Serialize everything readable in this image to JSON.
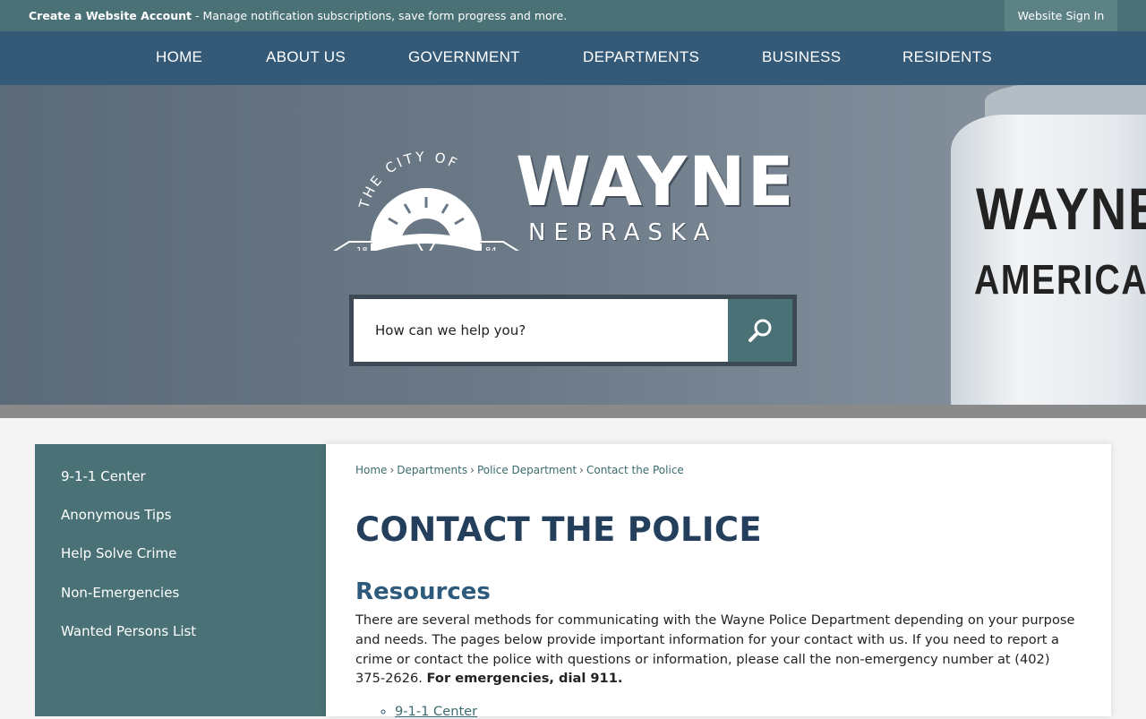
{
  "topbar": {
    "account_link": "Create a Website Account",
    "account_desc": " - Manage notification subscriptions, save form progress and more.",
    "signin_label": "Website Sign In"
  },
  "nav": {
    "items": [
      "HOME",
      "ABOUT US",
      "GOVERNMENT",
      "DEPARTMENTS",
      "BUSINESS",
      "RESIDENTS"
    ]
  },
  "hero": {
    "logo_arc_text": "THE CITY OF",
    "logo_word": "WAYNE",
    "logo_sub": "NEBRASKA",
    "logo_year_left": "18",
    "logo_year_right": "84",
    "tower_line1": "WAYNE",
    "tower_line2": "AMERICA",
    "search_placeholder": "How can we help you?",
    "search_icon": "magnifier-icon"
  },
  "sidebar": {
    "items": [
      "9-1-1 Center",
      "Anonymous Tips",
      "Help Solve Crime",
      "Non-Emergencies",
      "Wanted Persons List"
    ]
  },
  "breadcrumb": {
    "items": [
      "Home",
      "Departments",
      "Police Department",
      "Contact the Police"
    ],
    "separator": "›"
  },
  "page": {
    "title": "CONTACT THE POLICE",
    "section_title": "Resources",
    "paragraph_text": "There are several methods for communicating with the Wayne Police Department depending on your purpose and needs.  The pages below provide important information for your contact with us.  If you need to report a crime or contact the police with questions or information, please call the non-emergency number at (402) 375-2626.  ",
    "paragraph_bold": "For emergencies, dial 911.",
    "list": [
      "9-1-1 Center"
    ]
  },
  "colors": {
    "topbar": "#4a7175",
    "nav": "#355a78",
    "sidebar": "#4a7175",
    "title": "#243f5c"
  }
}
